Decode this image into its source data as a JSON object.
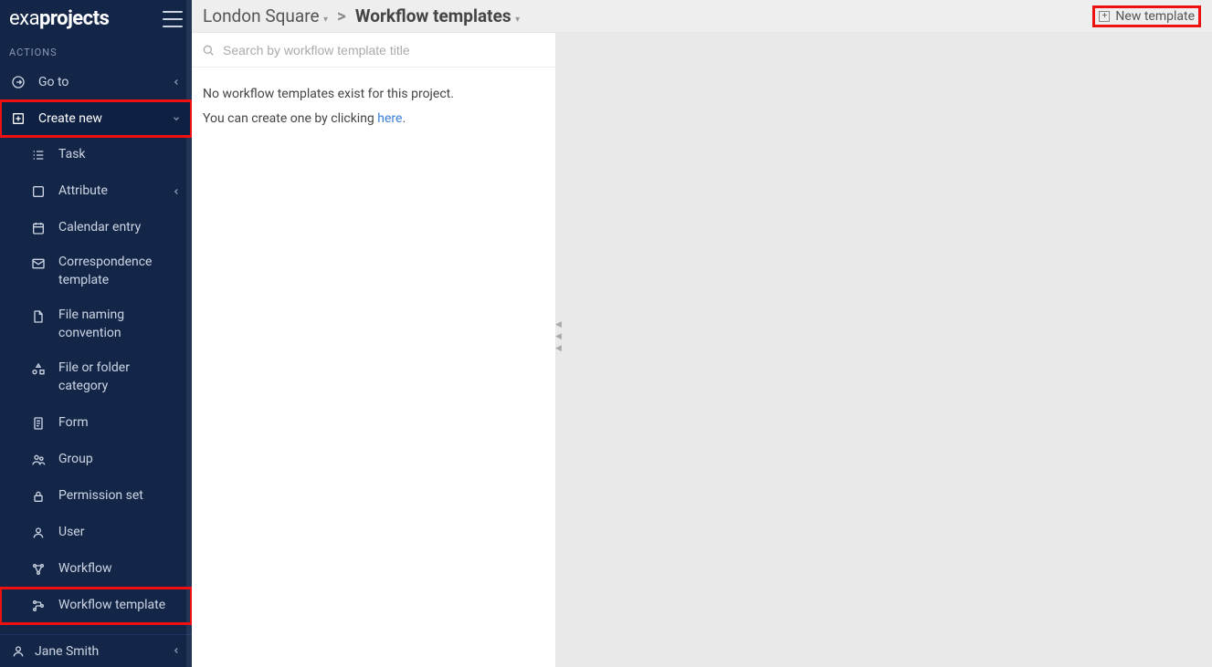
{
  "app": {
    "brand_prefix": "exa",
    "brand_bold": "projects"
  },
  "sidebar": {
    "section": "ACTIONS",
    "goto": "Go to",
    "create": "Create new",
    "items": [
      {
        "label": "Task"
      },
      {
        "label": "Attribute",
        "chev": true
      },
      {
        "label": "Calendar entry"
      },
      {
        "label": "Correspondence template",
        "multi": true
      },
      {
        "label": "File naming convention",
        "multi": true
      },
      {
        "label": "File or folder category",
        "multi": true
      },
      {
        "label": "Form"
      },
      {
        "label": "Group"
      },
      {
        "label": "Permission set"
      },
      {
        "label": "User"
      },
      {
        "label": "Workflow"
      },
      {
        "label": "Workflow template"
      }
    ],
    "user": "Jane Smith"
  },
  "breadcrumb": {
    "project": "London Square",
    "sep": ">",
    "page": "Workflow templates"
  },
  "actions": {
    "new_template": "New template"
  },
  "search": {
    "placeholder": "Search by workflow template title"
  },
  "empty_state": {
    "line1": "No workflow templates exist for this project.",
    "line2_prefix": "You can create one by clicking ",
    "link": "here",
    "line2_suffix": "."
  }
}
